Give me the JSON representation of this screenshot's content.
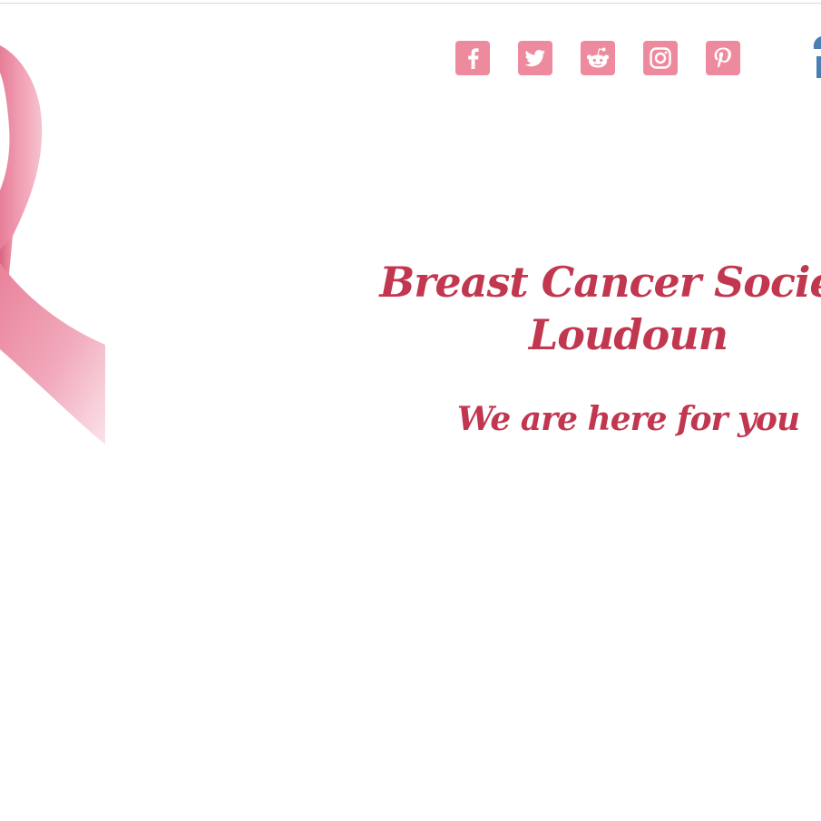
{
  "header": {
    "social_links": [
      {
        "network": "Facebook",
        "icon": "facebook-icon"
      },
      {
        "network": "Twitter",
        "icon": "twitter-icon"
      },
      {
        "network": "Reddit",
        "icon": "reddit-icon"
      },
      {
        "network": "Instagram",
        "icon": "instagram-icon"
      },
      {
        "network": "Pinterest",
        "icon": "pinterest-icon"
      }
    ],
    "icon_color": "#ee8a9d"
  },
  "hero": {
    "title_line_1": "Breast Cancer Society",
    "title_line_2": "Loudoun",
    "tagline": "We are here for you",
    "text_color": "#c1374f",
    "ribbon_color": "#ec8fa5"
  }
}
